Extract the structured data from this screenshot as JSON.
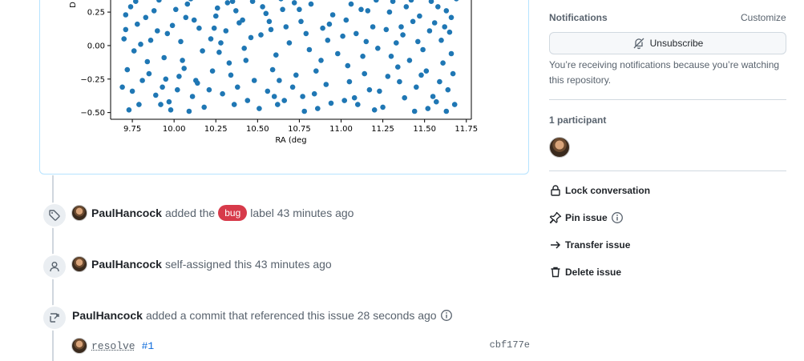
{
  "chart_data": {
    "type": "scatter",
    "xlabel": "RA (deg",
    "ylabel": "D",
    "xlim": [
      9.62,
      11.78
    ],
    "ylim_visible": [
      -0.55,
      0.4
    ],
    "x_ticks": [
      "9.75",
      "10.00",
      "10.25",
      "10.50",
      "10.75",
      "11.00",
      "11.25",
      "11.50",
      "11.75"
    ],
    "y_ticks": [
      "0.25",
      "0.00",
      "−0.25",
      "−0.50"
    ],
    "point_color": "#1f77b4",
    "points": [
      [
        9.76,
        -0.04
      ],
      [
        9.83,
        0.21
      ],
      [
        10.06,
        -0.17
      ],
      [
        10.35,
        0.33
      ],
      [
        10.48,
        -0.26
      ],
      [
        10.77,
        -0.38
      ],
      [
        11.12,
        0.27
      ],
      [
        11.44,
        -0.49
      ],
      [
        9.71,
        0.12
      ],
      [
        9.97,
        -0.42
      ],
      [
        10.22,
        0.05
      ],
      [
        10.61,
        -0.07
      ],
      [
        10.93,
        0.16
      ],
      [
        11.28,
        -0.23
      ],
      [
        11.58,
        0.29
      ],
      [
        11.66,
        -0.06
      ],
      [
        9.69,
        -0.31
      ],
      [
        9.91,
        0.34
      ],
      [
        10.14,
        -0.28
      ],
      [
        10.41,
        0.19
      ],
      [
        10.69,
        0.02
      ],
      [
        10.86,
        -0.47
      ],
      [
        11.04,
        -0.15
      ],
      [
        11.37,
        0.08
      ],
      [
        9.79,
        -0.44
      ],
      [
        10.01,
        0.27
      ],
      [
        10.29,
        -0.36
      ],
      [
        10.55,
        0.24
      ],
      [
        10.82,
        0.31
      ],
      [
        11.17,
        -0.33
      ],
      [
        11.51,
        -0.19
      ],
      [
        11.62,
        0.14
      ],
      [
        9.74,
        0.29
      ],
      [
        9.94,
        -0.09
      ],
      [
        10.19,
        0.36
      ],
      [
        10.44,
        -0.41
      ],
      [
        10.73,
        -0.22
      ],
      [
        11.01,
        0.07
      ],
      [
        11.31,
        0.33
      ],
      [
        11.55,
        -0.38
      ],
      [
        9.86,
        0.04
      ],
      [
        10.09,
        -0.49
      ],
      [
        10.33,
        -0.13
      ],
      [
        10.58,
        0.12
      ],
      [
        10.91,
        -0.29
      ],
      [
        11.22,
        -0.02
      ],
      [
        11.47,
        0.22
      ],
      [
        11.69,
        0.35
      ],
      [
        9.72,
        -0.18
      ],
      [
        9.99,
        0.15
      ],
      [
        10.25,
        0.22
      ],
      [
        10.51,
        -0.47
      ],
      [
        10.79,
        0.09
      ],
      [
        11.08,
        -0.39
      ],
      [
        11.35,
        -0.27
      ],
      [
        11.64,
        -0.33
      ],
      [
        9.81,
        -0.26
      ],
      [
        10.04,
        0.03
      ],
      [
        10.27,
        -0.05
      ],
      [
        10.64,
        0.35
      ],
      [
        10.95,
        0.23
      ],
      [
        11.19,
        0.14
      ],
      [
        11.41,
        -0.11
      ],
      [
        11.6,
        0.04
      ],
      [
        9.7,
        0.05
      ],
      [
        9.89,
        -0.37
      ],
      [
        10.12,
        0.19
      ],
      [
        10.38,
        -0.31
      ],
      [
        10.66,
        -0.41
      ],
      [
        10.98,
        -0.06
      ],
      [
        11.25,
        -0.46
      ],
      [
        11.53,
        0.11
      ],
      [
        9.77,
        0.33
      ],
      [
        10.03,
        -0.23
      ],
      [
        10.31,
        0.11
      ],
      [
        10.46,
        0.06
      ],
      [
        10.75,
        0.27
      ],
      [
        11.06,
        0.31
      ],
      [
        11.33,
        0.02
      ],
      [
        11.67,
        -0.21
      ],
      [
        9.84,
        -0.12
      ],
      [
        10.17,
        -0.04
      ],
      [
        10.36,
        -0.44
      ],
      [
        10.59,
        -0.18
      ],
      [
        10.88,
        -0.11
      ],
      [
        11.14,
        -0.21
      ],
      [
        11.43,
        0.18
      ],
      [
        11.57,
        -0.42
      ],
      [
        9.73,
        -0.48
      ],
      [
        9.96,
        0.09
      ],
      [
        10.23,
        -0.19
      ],
      [
        10.53,
        0.29
      ],
      [
        10.71,
        -0.31
      ],
      [
        11.03,
        0.19
      ],
      [
        11.29,
        0.25
      ],
      [
        11.63,
        0.26
      ],
      [
        9.93,
        -0.31
      ],
      [
        10.08,
        0.31
      ],
      [
        10.42,
        -0.02
      ],
      [
        10.67,
        0.14
      ],
      [
        10.84,
        -0.36
      ],
      [
        11.1,
        -0.44
      ],
      [
        11.38,
        -0.39
      ],
      [
        11.49,
        -0.03
      ],
      [
        9.78,
        0.16
      ],
      [
        10.11,
        -0.38
      ],
      [
        10.26,
        0.28
      ],
      [
        10.56,
        -0.34
      ],
      [
        10.81,
        -0.03
      ],
      [
        11.15,
        0.03
      ],
      [
        11.45,
        -0.31
      ],
      [
        11.68,
        -0.44
      ],
      [
        9.88,
        0.26
      ],
      [
        10.05,
        -0.11
      ],
      [
        10.39,
        0.17
      ],
      [
        10.63,
        -0.26
      ],
      [
        10.92,
        0.04
      ],
      [
        11.21,
        0.34
      ],
      [
        11.39,
        0.29
      ],
      [
        11.61,
        -0.13
      ],
      [
        9.75,
        -0.34
      ],
      [
        9.98,
        -0.48
      ],
      [
        10.21,
        -0.33
      ],
      [
        10.47,
        0.33
      ],
      [
        10.76,
        0.18
      ],
      [
        11.05,
        -0.27
      ],
      [
        11.27,
        0.12
      ],
      [
        11.54,
        0.33
      ],
      [
        9.82,
        0.36
      ],
      [
        10.15,
        0.13
      ],
      [
        10.34,
        -0.22
      ],
      [
        10.62,
        -0.44
      ],
      [
        10.96,
        0.36
      ],
      [
        11.23,
        -0.34
      ],
      [
        11.46,
        0.03
      ],
      [
        11.65,
        0.1
      ],
      [
        9.9,
        0.11
      ],
      [
        10.07,
        0.21
      ],
      [
        10.28,
        0.02
      ],
      [
        10.57,
        0.18
      ],
      [
        10.78,
        -0.49
      ],
      [
        11.09,
        0.09
      ],
      [
        11.34,
        -0.16
      ],
      [
        11.59,
        -0.27
      ],
      [
        9.71,
        0.23
      ],
      [
        9.95,
        -0.25
      ],
      [
        10.18,
        -0.46
      ],
      [
        10.43,
        -0.11
      ],
      [
        10.72,
        0.32
      ],
      [
        11.02,
        -0.41
      ],
      [
        11.3,
        -0.08
      ],
      [
        11.52,
        -0.47
      ],
      [
        9.85,
        -0.21
      ],
      [
        10.1,
        0.35
      ],
      [
        10.37,
        0.26
      ],
      [
        10.6,
        -0.38
      ],
      [
        10.89,
        0.13
      ],
      [
        11.16,
        0.26
      ],
      [
        11.42,
        0.34
      ],
      [
        11.66,
        0.21
      ],
      [
        9.8,
        0.01
      ],
      [
        10.02,
        -0.33
      ],
      [
        10.24,
        0.13
      ],
      [
        10.52,
        0.08
      ],
      [
        10.85,
        -0.19
      ],
      [
        11.13,
        -0.08
      ],
      [
        11.36,
        0.14
      ],
      [
        11.56,
        0.17
      ],
      [
        9.92,
        -0.44
      ],
      [
        10.13,
        -0.26
      ],
      [
        10.32,
        0.32
      ],
      [
        10.65,
        0.27
      ],
      [
        10.94,
        -0.43
      ],
      [
        11.2,
        -0.48
      ],
      [
        11.48,
        -0.22
      ],
      [
        11.63,
        -0.49
      ]
    ]
  },
  "timeline": {
    "event1": {
      "author": "PaulHancock",
      "before": "added the",
      "label": "bug",
      "after": "label 43 minutes ago"
    },
    "event2": {
      "author": "PaulHancock",
      "text": "self-assigned this 43 minutes ago"
    },
    "event3": {
      "author": "PaulHancock",
      "text": "added a commit that referenced this issue 28 seconds ago"
    },
    "commit": {
      "message": "resolve",
      "ref": "#1",
      "sha": "cbf177e"
    }
  },
  "sidebar": {
    "notifications_heading": "Notifications",
    "customize": "Customize",
    "unsubscribe": "Unsubscribe",
    "note": "You’re receiving notifications because you’re watching this repository.",
    "participants_heading": "1 participant",
    "lock": "Lock conversation",
    "pin": "Pin issue",
    "transfer": "Transfer issue",
    "delete": "Delete issue"
  },
  "colors": {
    "bug_label": "#d73a4a",
    "link": "#0969da",
    "card_border": "#b6e3ff"
  }
}
